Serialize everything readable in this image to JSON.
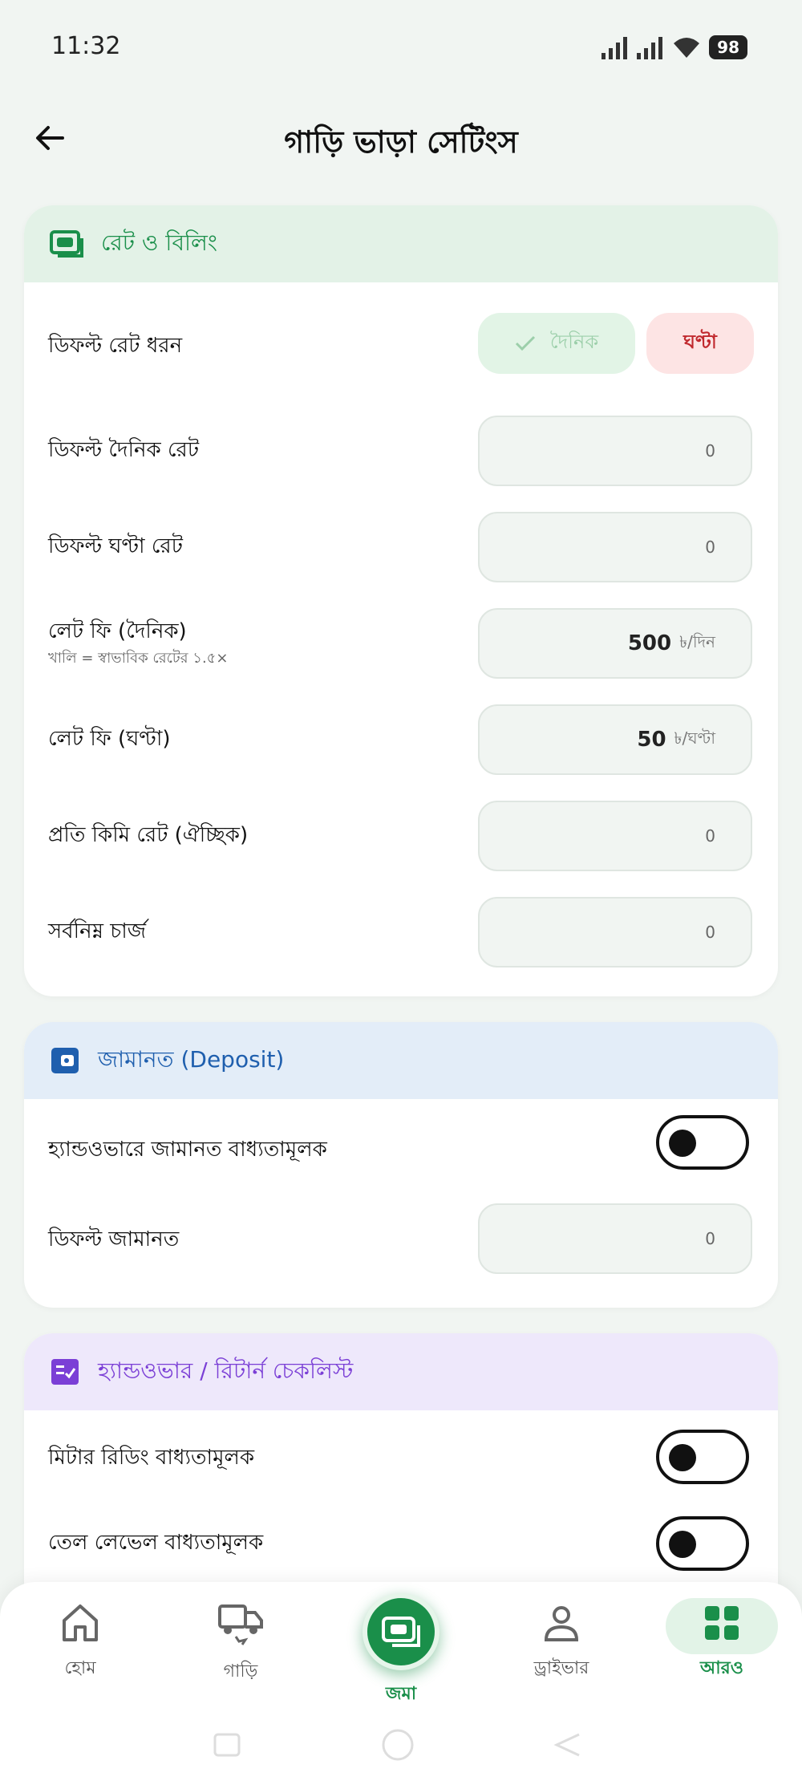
{
  "status": {
    "time": "11:32",
    "battery": "98"
  },
  "appbar": {
    "title": "গাড়ি ভাড়া সেটিংস"
  },
  "billing": {
    "header": "রেট ও বিলিং",
    "rate_type_label": "ডিফল্ট রেট ধরন",
    "daily_option": "দৈনিক",
    "hourly_option": "ঘণ্টা",
    "default_daily_label": "ডিফল্ট দৈনিক রেট",
    "default_daily_placeholder": "0",
    "default_hourly_label": "ডিফল্ট ঘণ্টা রেট",
    "default_hourly_placeholder": "0",
    "late_fee_daily_label": "লেট ফি (দৈনিক)",
    "late_fee_daily_hint": "খালি = স্বাভাবিক রেটের ১.৫×",
    "late_fee_daily_value": "500",
    "late_fee_daily_unit": "৳/দিন",
    "late_fee_hourly_label": "লেট ফি (ঘণ্টা)",
    "late_fee_hourly_value": "50",
    "late_fee_hourly_unit": "৳/ঘণ্টা",
    "per_km_label": "প্রতি কিমি রেট (ঐচ্ছিক)",
    "per_km_placeholder": "0",
    "min_charge_label": "সর্বনিম্ন চার্জ",
    "min_charge_placeholder": "0"
  },
  "deposit": {
    "header": "জামানত (Deposit)",
    "required_label": "হ্যান্ডওভারে জামানত বাধ্যতামূলক",
    "required_on": false,
    "default_label": "ডিফল্ট জামানত",
    "default_placeholder": "0"
  },
  "checklist": {
    "header": "হ্যান্ডওভার / রিটার্ন চেকলিস্ট",
    "meter_label": "মিটার রিডিং বাধ্যতামূলক",
    "meter_on": false,
    "fuel_label": "তেল লেভেল বাধ্যতামূলক",
    "fuel_on": false
  },
  "nav": {
    "home": "হোম",
    "vehicle": "গাড়ি",
    "deposit": "জমা",
    "driver": "ড্রাইভার",
    "more": "আরও"
  },
  "colors": {
    "green": "#1a8f4a",
    "blue": "#1f5fae",
    "purple": "#7b3fd6",
    "red": "#c0282d"
  }
}
